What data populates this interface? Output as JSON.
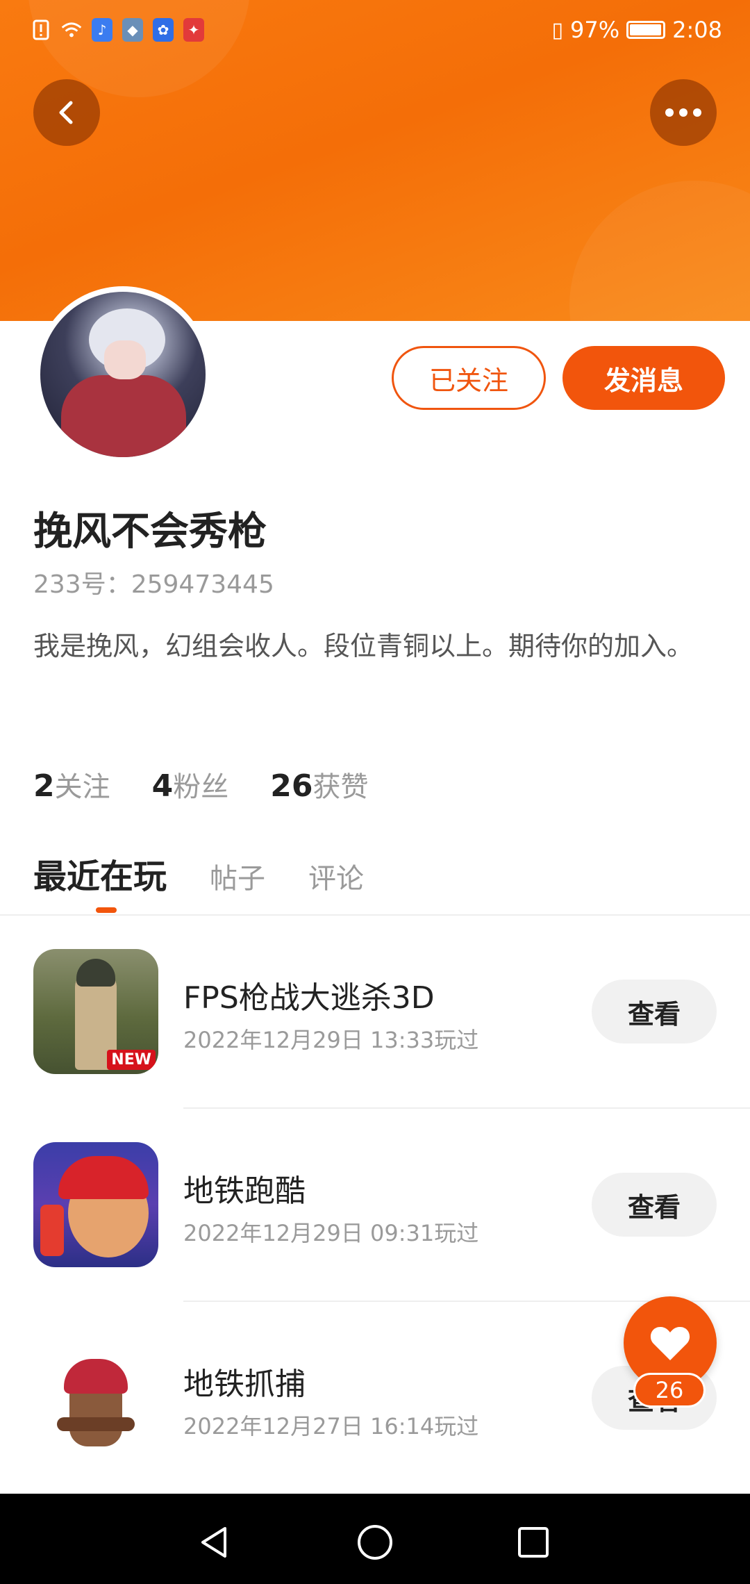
{
  "status_bar": {
    "battery": "97%",
    "time": "2:08",
    "notification_icons": [
      "alert-icon",
      "wifi-icon",
      "app-icon",
      "app-icon",
      "baidu-icon",
      "app-icon"
    ]
  },
  "profile": {
    "username": "挽风不会秀枪",
    "id_text": "233号：259473445",
    "bio": "我是挽风，幻组会收人。段位青铜以上。期待你的加入。",
    "follow_button": "已关注",
    "message_button": "发消息"
  },
  "stats": [
    {
      "num": "2",
      "label": "关注"
    },
    {
      "num": "4",
      "label": "粉丝"
    },
    {
      "num": "26",
      "label": "获赞"
    }
  ],
  "tabs": [
    {
      "label": "最近在玩",
      "active": true
    },
    {
      "label": "帖子",
      "active": false
    },
    {
      "label": "评论",
      "active": false
    }
  ],
  "games": [
    {
      "title": "FPS枪战大逃杀3D",
      "time": "2022年12月29日 13:33玩过",
      "button": "查看",
      "badge": "NEW"
    },
    {
      "title": "地铁跑酷",
      "time": "2022年12月29日 09:31玩过",
      "button": "查看"
    },
    {
      "title": "地铁抓捕",
      "time": "2022年12月27日 16:14玩过",
      "button": "查看"
    }
  ],
  "like_fab": {
    "count": "26"
  },
  "colors": {
    "accent": "#f2550c",
    "header": "#f97a10"
  }
}
